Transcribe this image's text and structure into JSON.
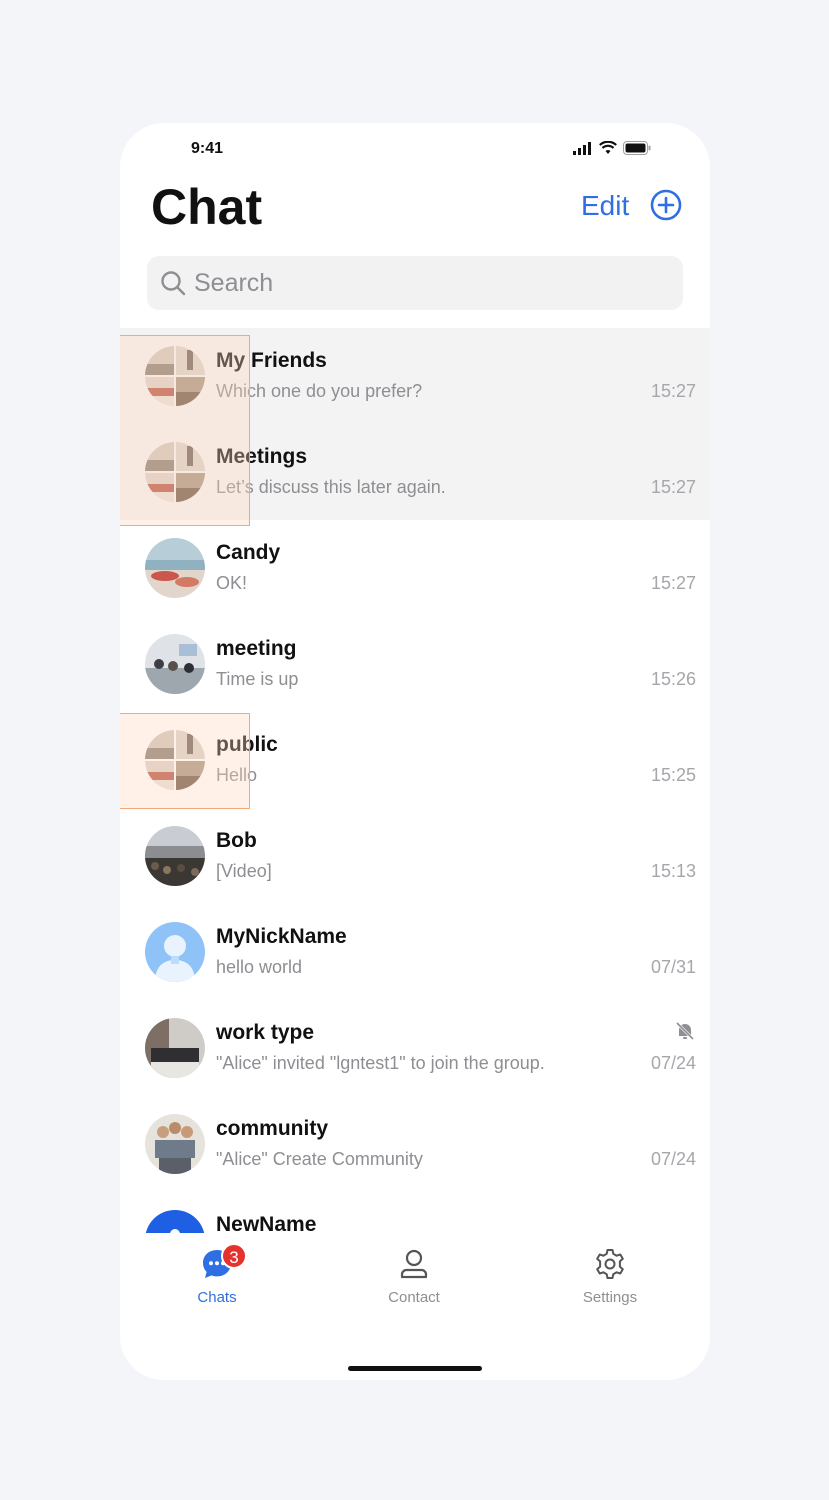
{
  "status": {
    "time": "9:41"
  },
  "header": {
    "title": "Chat",
    "edit_label": "Edit",
    "add_icon": "plus-circle-icon"
  },
  "search": {
    "placeholder": "Search"
  },
  "chats": [
    {
      "name": "My Friends",
      "message": "Which one do you prefer?",
      "time": "15:27",
      "pinned": true,
      "avatar": "group-collage"
    },
    {
      "name": "Meetings",
      "message": "Let’s discuss this later again.",
      "time": "15:27",
      "pinned": true,
      "avatar": "group-collage"
    },
    {
      "name": "Candy",
      "message": "OK!",
      "time": "15:27",
      "pinned": false,
      "avatar": "beach-photo"
    },
    {
      "name": "meeting",
      "message": "Time is up",
      "time": "15:26",
      "pinned": false,
      "avatar": "office-photo"
    },
    {
      "name": "public",
      "message": "Hello",
      "time": "15:25",
      "pinned": false,
      "avatar": "group-collage"
    },
    {
      "name": "Bob",
      "message": "[Video]",
      "time": "15:13",
      "pinned": false,
      "avatar": "crowd-photo"
    },
    {
      "name": "MyNickName",
      "message": "hello world",
      "time": "07/31",
      "pinned": false,
      "avatar": "default-blue-avatar"
    },
    {
      "name": "work type",
      "message": "\"Alice\" invited \"lgntest1\" to join the group.",
      "time": "07/24",
      "pinned": false,
      "muted": true,
      "avatar": "desk-photo"
    },
    {
      "name": "community",
      "message": "\"Alice\" Create Community",
      "time": "07/24",
      "pinned": false,
      "avatar": "people-photo"
    },
    {
      "name": "NewName",
      "message": "",
      "time": "",
      "pinned": false,
      "avatar": "blue-user-avatar"
    }
  ],
  "tabs": [
    {
      "label": "Chats",
      "icon": "chat-bubble-icon",
      "active": true,
      "badge": "3"
    },
    {
      "label": "Contact",
      "icon": "person-icon",
      "active": false
    },
    {
      "label": "Settings",
      "icon": "gear-icon",
      "active": false
    }
  ],
  "colors": {
    "accent": "#2f6fe4",
    "badge": "#e5322d",
    "pinned_bg": "#f3f3f4"
  }
}
